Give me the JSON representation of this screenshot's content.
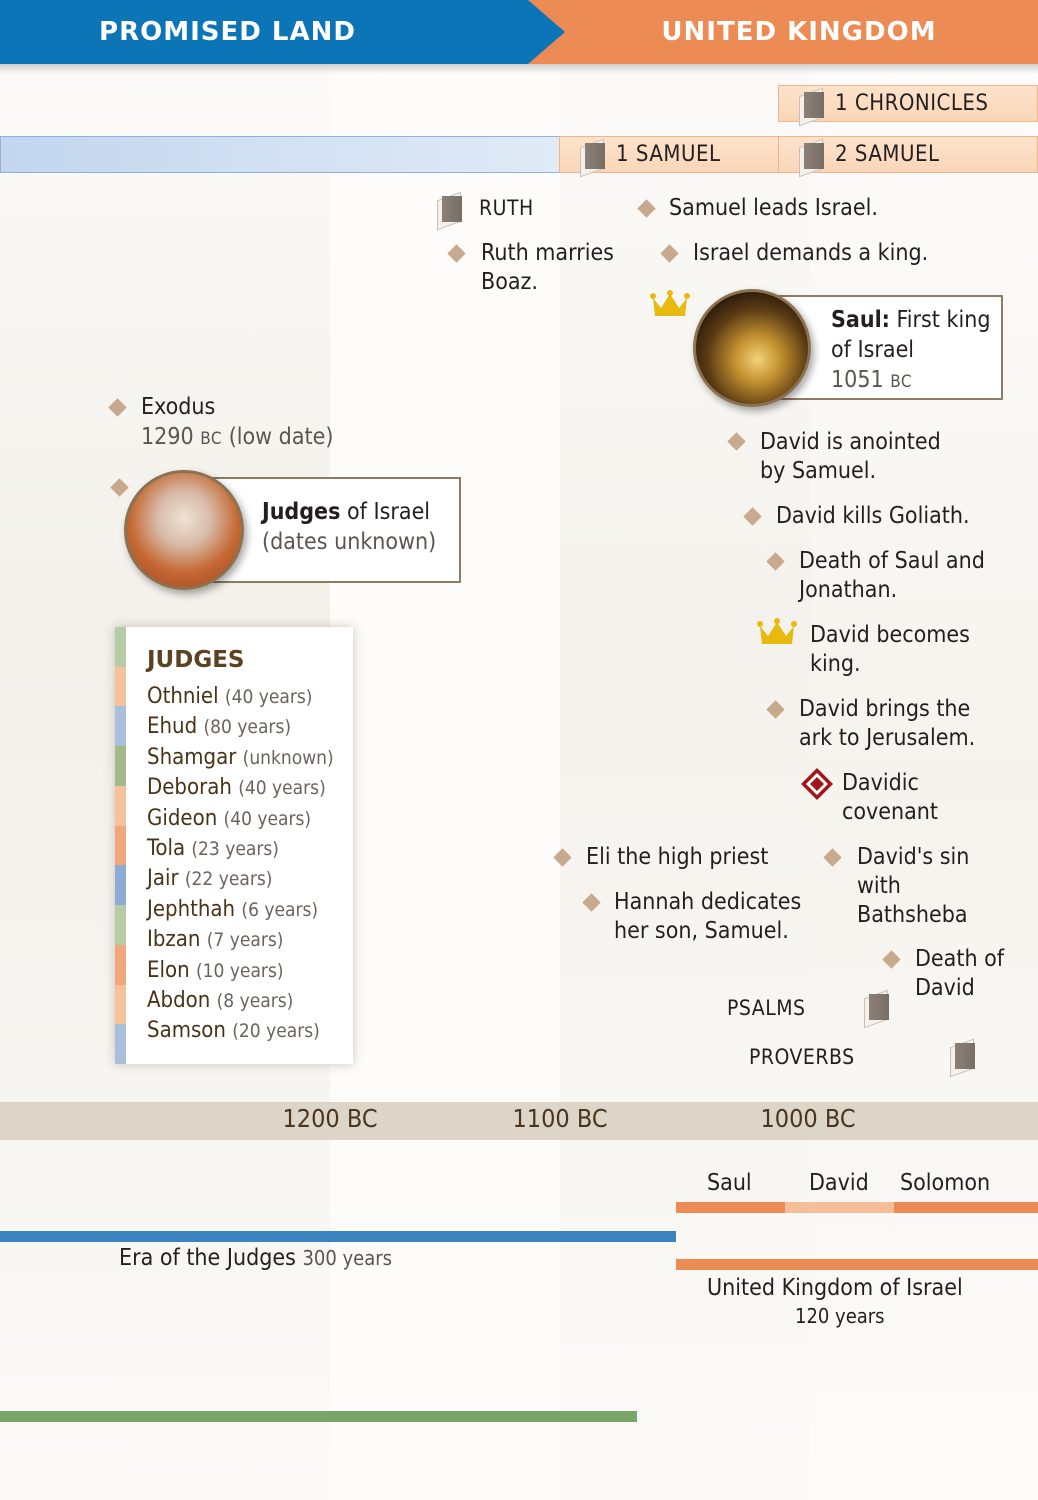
{
  "header": {
    "left_era": "PROMISED LAND",
    "right_era": "UNITED KINGDOM",
    "left_color": "#0b75b8",
    "right_color": "#ec8b53"
  },
  "books": {
    "chronicles1": "1 CHRONICLES",
    "samuel1": "1 SAMUEL",
    "samuel2": "2 SAMUEL",
    "ruth": "RUTH",
    "psalms": "PSALMS",
    "proverbs": "PROVERBS"
  },
  "events": {
    "ruth_marries": "Ruth marries Boaz.",
    "samuel_leads": "Samuel leads Israel.",
    "israel_demands": "Israel demands a king.",
    "exodus": "Exodus",
    "exodus_date": "1290",
    "exodus_bc": "BC",
    "exodus_note": "(low date)",
    "david_anointed": "David is anointed by Samuel.",
    "david_goliath": "David kills Goliath.",
    "death_saul": "Death of Saul and Jonathan.",
    "david_king": "David becomes king.",
    "david_ark": "David brings the ark to Jerusalem.",
    "davidic_covenant": "Davidic covenant",
    "eli": "Eli the high priest",
    "hannah": "Hannah dedicates her son, Samuel.",
    "david_sin": "David's sin with Bathsheba",
    "death_david": "Death of David"
  },
  "saul_callout": {
    "bold": "Saul:",
    "text": "First king of Israel",
    "date": "1051",
    "bc": "BC"
  },
  "judges_callout": {
    "bold": "Judges",
    "text": "of Israel",
    "note": "(dates unknown)"
  },
  "judges_list": {
    "title": "JUDGES",
    "items": [
      {
        "name": "Othniel",
        "years": "(40 years)"
      },
      {
        "name": "Ehud",
        "years": "(80 years)"
      },
      {
        "name": "Shamgar",
        "years": "(unknown)"
      },
      {
        "name": "Deborah",
        "years": "(40 years)"
      },
      {
        "name": "Gideon",
        "years": "(40 years)"
      },
      {
        "name": "Tola",
        "years": "(23 years)"
      },
      {
        "name": "Jair",
        "years": "(22 years)"
      },
      {
        "name": "Jephthah",
        "years": "(6 years)"
      },
      {
        "name": "Ibzan",
        "years": "(7 years)"
      },
      {
        "name": "Elon",
        "years": "(10 years)"
      },
      {
        "name": "Abdon",
        "years": "(8 years)"
      },
      {
        "name": "Samson",
        "years": "(20 years)"
      }
    ],
    "strip_colors": [
      "#b6cca6",
      "#f6c29b",
      "#a9c0dc",
      "#a3bb8a",
      "#f6c29b",
      "#f1a77c",
      "#8eabd6",
      "#b6cca6",
      "#f1a77c",
      "#f6c29b",
      "#a9c0dc"
    ]
  },
  "timeline": {
    "ticks": [
      "1200 BC",
      "1100 BC",
      "1000 BC"
    ],
    "kings": [
      "Saul",
      "David",
      "Solomon"
    ],
    "judges_era_label": "Era of the Judges",
    "judges_era_years": "300 years",
    "kingdom_label": "United Kingdom of Israel",
    "kingdom_years": "120 years"
  },
  "colors": {
    "diamond": "#c9a98e",
    "crown": "#e8b90f",
    "covenant": "#a3151c",
    "era_blue": "#3b82c0",
    "kingdom_orange": "#ec8b53",
    "green_bar": "#7aa56a"
  }
}
